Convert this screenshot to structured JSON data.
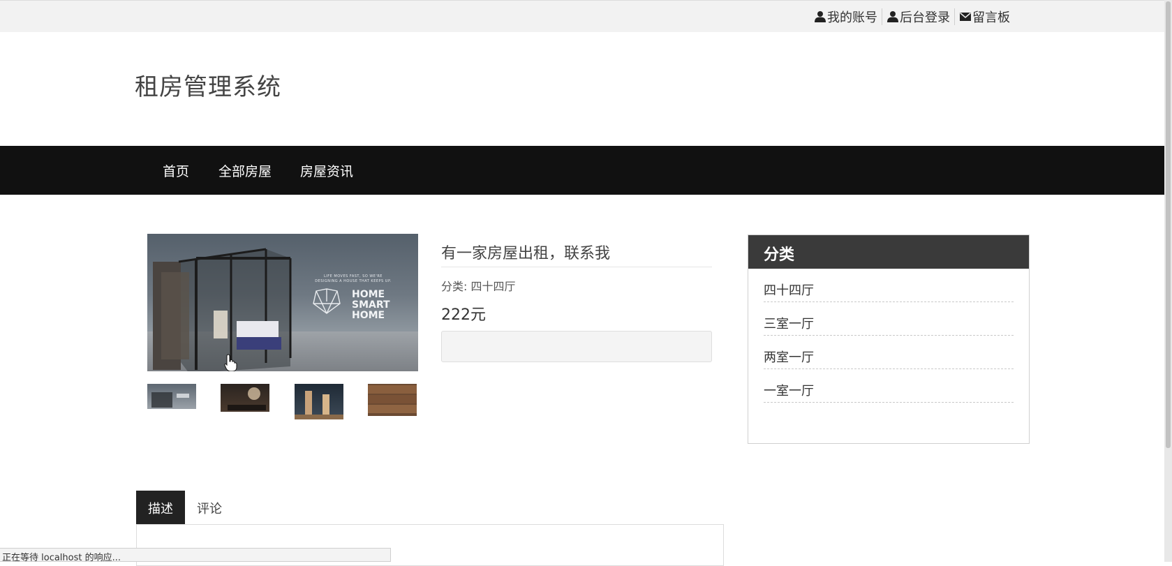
{
  "top_links": [
    {
      "icon": "user-icon",
      "label": "我的账号"
    },
    {
      "icon": "user-icon",
      "label": "后台登录"
    },
    {
      "icon": "envelope-icon",
      "label": "留言板"
    }
  ],
  "site_title": "租房管理系统",
  "nav": {
    "items": [
      "首页",
      "全部房屋",
      "房屋资讯"
    ]
  },
  "product": {
    "main_image_text": {
      "tagline_1": "LIFE MOVES FAST, SO WE'RE",
      "tagline_2": "DESIGNING A HOUSE THAT KEEPS UP.",
      "brand_1": "HOME",
      "brand_2": "SMART",
      "brand_3": "HOME"
    },
    "title": "有一家房屋出租，联系我",
    "category": "分类: 四十四厅",
    "price": "222元"
  },
  "category_panel": {
    "title": "分类",
    "items": [
      "四十四厅",
      "三室一厅",
      "两室一厅",
      "一室一厅"
    ]
  },
  "tabs": [
    "描述",
    "评论"
  ],
  "status_text": "正在等待 localhost 的响应..."
}
